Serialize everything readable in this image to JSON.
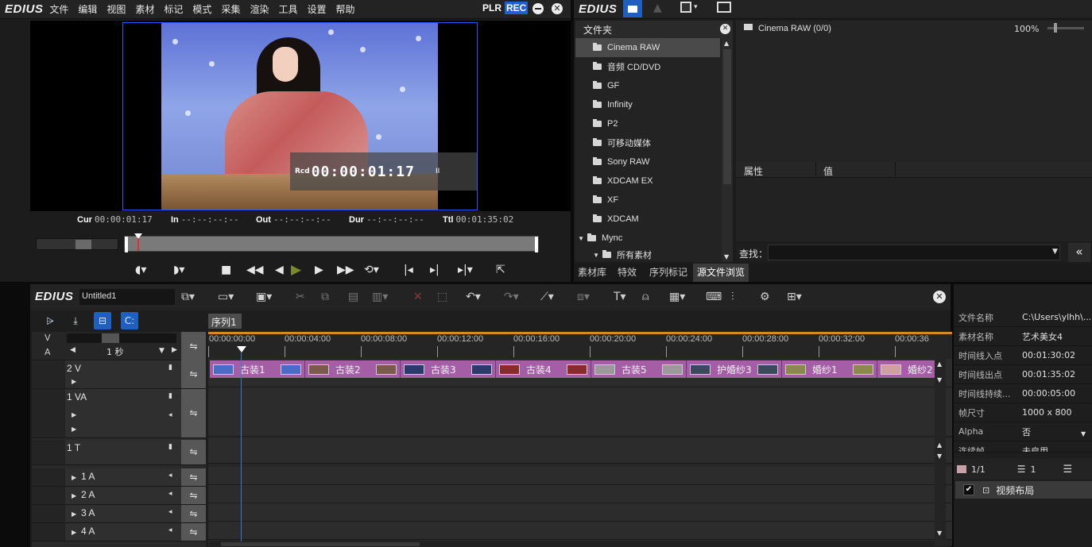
{
  "player": {
    "logo": "EDIUS",
    "menu": [
      "文件",
      "编辑",
      "视图",
      "素材",
      "标记",
      "模式",
      "采集",
      "渲染",
      "工具",
      "设置",
      "帮助"
    ],
    "plr": "PLR",
    "rec": "REC",
    "overlay_prefix": "Rcd",
    "overlay_timecode": "00:00:01:17",
    "overlay_pause": "II",
    "cur_label": "Cur",
    "cur_value": "00:00:01:17",
    "in_label": "In",
    "in_value": "--:--:--:--",
    "out_label": "Out",
    "out_value": "--:--:--:--",
    "dur_label": "Dur",
    "dur_value": "--:--:--:--",
    "ttl_label": "Ttl",
    "ttl_value": "00:01:35:02"
  },
  "bin": {
    "logo": "EDIUS",
    "folder_header": "文件夹",
    "folders": [
      "Cinema RAW",
      "音频 CD/DVD",
      "GF",
      "Infinity",
      "P2",
      "可移动媒体",
      "Sony RAW",
      "XDCAM EX",
      "XF",
      "XDCAM",
      "Mync",
      "所有素材"
    ],
    "clip_path": "Cinema RAW (0/0)",
    "zoom": "100%",
    "prop_col": "属性",
    "value_col": "值",
    "search_label": "查找：",
    "tabs": [
      "素材库",
      "特效",
      "序列标记",
      "源文件浏览"
    ],
    "active_tab": "源文件浏览"
  },
  "timeline": {
    "logo": "EDIUS",
    "sequence_name": "Untitled1",
    "sequence_tab": "序列1",
    "scale": "1 秒",
    "v_label": "V",
    "a_label": "A",
    "ticks": [
      "00:00:00:00",
      "00:00:04:00",
      "00:00:08:00",
      "00:00:12:00",
      "00:00:16:00",
      "00:00:20:00",
      "00:00:24:00",
      "00:00:28:00",
      "00:00:32:00",
      "00:00:36"
    ],
    "tracks": [
      "2 V",
      "1 VA",
      "1 T",
      "1 A",
      "2 A",
      "3 A",
      "4 A"
    ],
    "clips": [
      "古装1",
      "古装2",
      "古装3",
      "古装4",
      "古装5",
      "护婚纱3",
      "婚纱1",
      "婚纱2"
    ]
  },
  "info": {
    "rows": [
      {
        "k": "文件名称",
        "v": "C:\\Users\\ylhh\\..."
      },
      {
        "k": "素材名称",
        "v": "艺术美女4"
      },
      {
        "k": "时间线入点",
        "v": "00:01:30:02"
      },
      {
        "k": "时间线出点",
        "v": "00:01:35:02"
      },
      {
        "k": "时间线持续...",
        "v": "00:00:05:00"
      },
      {
        "k": "帧尺寸",
        "v": "1000 x 800"
      },
      {
        "k": "Alpha",
        "v": "否"
      },
      {
        "k": "连续帧",
        "v": "未启用"
      }
    ],
    "page": "1/1",
    "count": "1",
    "layout_label": "视频布局",
    "layout_checked": "✔"
  }
}
